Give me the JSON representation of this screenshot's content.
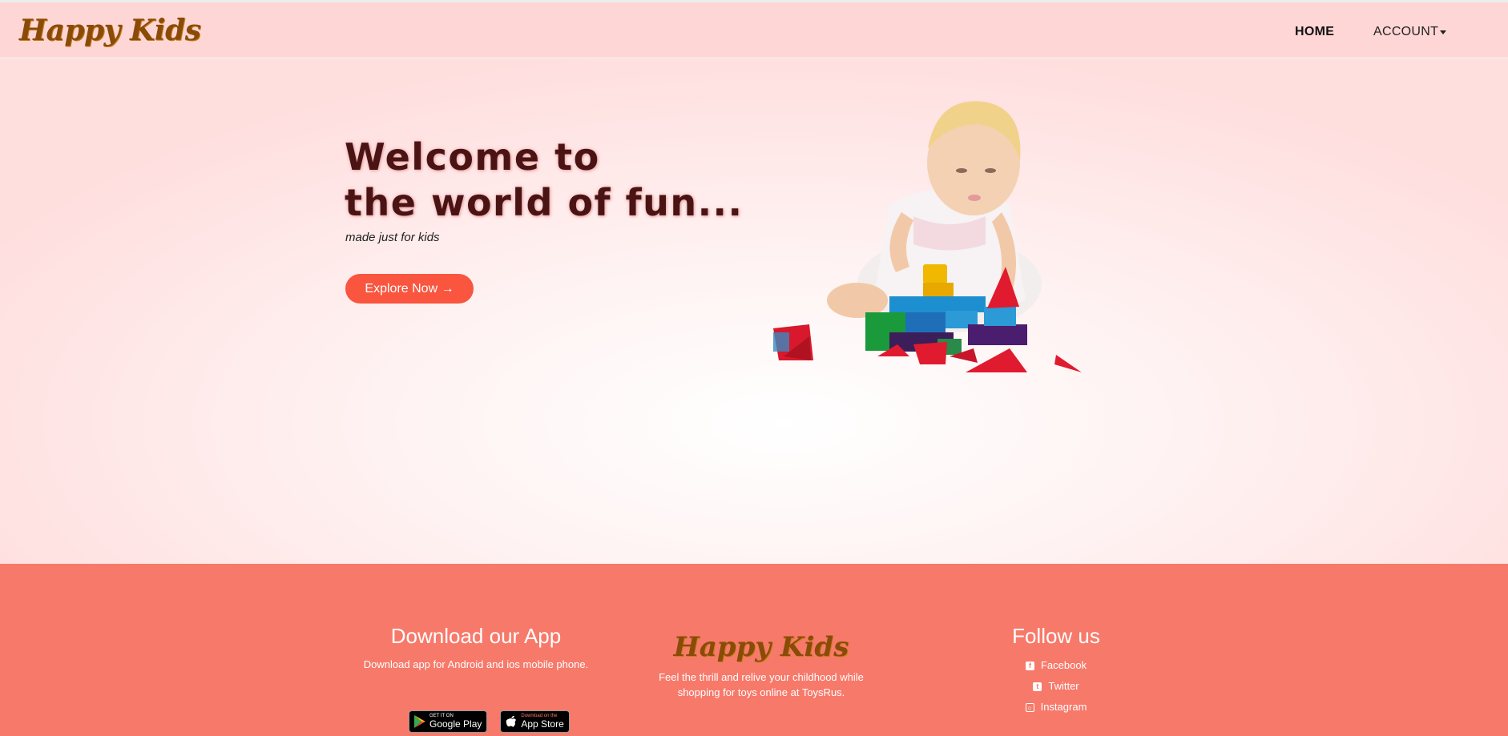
{
  "navbar": {
    "brand": "Happy Kids",
    "links": {
      "home": "HOME",
      "account": "ACCOUNT"
    }
  },
  "hero": {
    "title_line1": "Welcome to",
    "title_line2": "the world of fun...",
    "subtitle": "made just for kids",
    "cta_label": "Explore Now →"
  },
  "footer": {
    "app": {
      "title": "Download our App",
      "desc": "Download app for Android and ios mobile phone.",
      "google_small": "GET IT ON",
      "google_big": "Google Play",
      "apple_small": "Download on the",
      "apple_big": "App Store"
    },
    "brand": {
      "name": "Happy Kids",
      "desc_line1": "Feel the thrill and relive your childhood while",
      "desc_line2": "shopping for toys online at ToysRus."
    },
    "follow": {
      "title": "Follow us",
      "items": [
        {
          "label": "Facebook",
          "icon": "facebook-icon"
        },
        {
          "label": "Twitter",
          "icon": "twitter-icon"
        },
        {
          "label": "Instagram",
          "icon": "instagram-icon"
        }
      ]
    }
  },
  "colors": {
    "navbar_bg": "#ffd6d6",
    "brand": "#8a4b08",
    "cta": "#f9553f",
    "footer_bg": "#f7796a"
  }
}
